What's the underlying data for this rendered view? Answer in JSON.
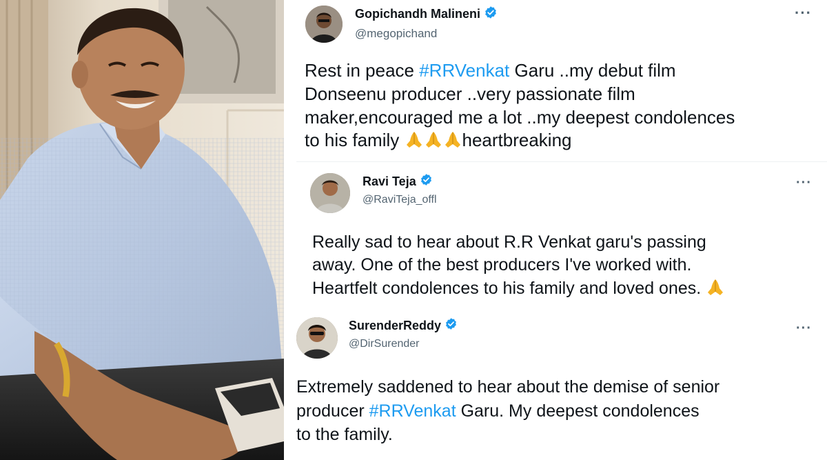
{
  "colors": {
    "text_primary": "#0f1419",
    "text_secondary": "#536471",
    "link_blue": "#1d9bf0",
    "verified_blue": "#1d9bf0"
  },
  "photo": {
    "subject": "smiling-man-portrait"
  },
  "tweets": [
    {
      "display_name": "Gopichandh Malineni",
      "handle": "@megopichand",
      "verified": true,
      "more_icon": "more-horizontal-icon",
      "text_parts": {
        "a": "Rest in peace ",
        "hashtag": "#RRVenkat",
        "b": " Garu ..my debut film\nDonseenu producer ..very passionate film\nmaker,encouraged me a lot ..my deepest condolences\nto his family ",
        "c": "heartbreaking"
      },
      "emoji": [
        "folded-hands-icon",
        "folded-hands-icon",
        "folded-hands-icon"
      ]
    },
    {
      "display_name": "Ravi Teja",
      "handle": "@RaviTeja_offl",
      "verified": true,
      "more_icon": "more-horizontal-icon",
      "text_parts": {
        "a": "Really sad to hear about R.R Venkat garu's passing\naway. One of the best producers I've worked with.\nHeartfelt condolences to his family and loved ones. "
      },
      "emoji": [
        "folded-hands-icon"
      ]
    },
    {
      "display_name": "SurenderReddy",
      "handle": "@DirSurender",
      "verified": true,
      "more_icon": "more-horizontal-icon",
      "text_parts": {
        "a": "Extremely saddened to hear about the demise of senior\nproducer ",
        "hashtag": "#RRVenkat",
        "b": " Garu. My deepest condolences\nto the family."
      },
      "emoji": []
    }
  ]
}
